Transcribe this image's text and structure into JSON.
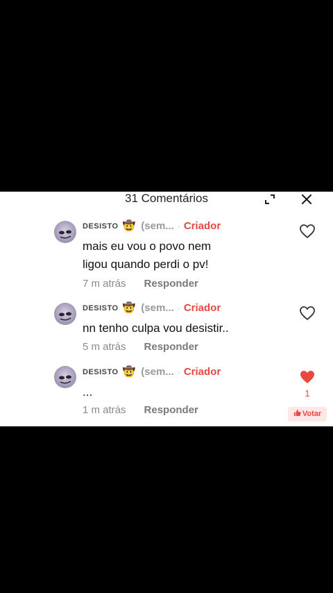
{
  "header": {
    "title": "31 Comentários"
  },
  "comments": [
    {
      "username": "DESISTO",
      "emoji": "🤠",
      "status": "(sem...",
      "badge": "Criador",
      "lines": [
        "mais eu vou o povo nem",
        "ligou quando perdi o pv!"
      ],
      "time": "7 m atrás",
      "reply": "Responder",
      "liked": false
    },
    {
      "username": "DESISTO",
      "emoji": "🤠",
      "status": "(sem...",
      "badge": "Criador",
      "lines": [
        "nn tenho culpa vou desistir.."
      ],
      "time": "5 m atrás",
      "reply": "Responder",
      "liked": false
    },
    {
      "username": "DESISTO",
      "emoji": "🤠",
      "status": "(sem...",
      "badge": "Criador",
      "lines": [
        "..."
      ],
      "time": "1 m atrás",
      "reply": "Responder",
      "liked": true,
      "like_count": "1",
      "vote_label": "Votar"
    }
  ],
  "colors": {
    "accent": "#e8483f",
    "background": "#000000",
    "panel": "#ffffff"
  }
}
